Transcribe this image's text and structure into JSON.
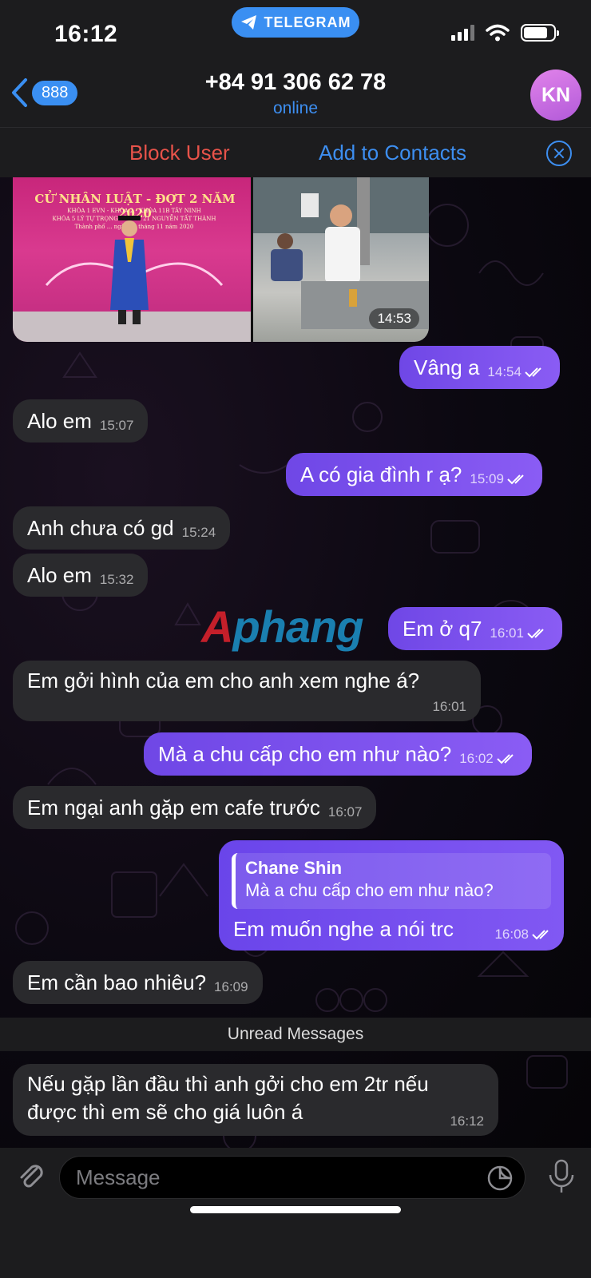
{
  "status_bar": {
    "time": "16:12",
    "app_pill": "TELEGRAM"
  },
  "header": {
    "back_count": "888",
    "title": "+84 91 306 62 78",
    "subtitle": "online",
    "avatar_initials": "KN"
  },
  "actions": {
    "block": "Block User",
    "add": "Add to Contacts"
  },
  "photo_album": {
    "time": "14:53",
    "banner_title": "CỬ NHÂN LUẬT - ĐỢT 2 NĂM 2020",
    "banner_line_1": "KHÓA 1 EVN - KHÓA 2 - KHÓA 11B TÂY NINH",
    "banner_line_2": "KHÓA 5 LÝ TỰ TRỌNG - KHÓA 21 NGUYỄN TẤT THÀNH",
    "banner_line_3": "Thành phố ... ngày 28 tháng 11 năm 2020"
  },
  "messages": [
    {
      "dir": "out",
      "text": "Vâng a",
      "time": "14:54"
    },
    {
      "dir": "in",
      "text": "Alo em",
      "time": "15:07"
    },
    {
      "dir": "out",
      "text": "A có gia đình r ạ?",
      "time": "15:09"
    },
    {
      "dir": "in",
      "text": "Anh chưa có gd",
      "time": "15:24"
    },
    {
      "dir": "in",
      "text": "Alo em",
      "time": "15:32"
    },
    {
      "dir": "out",
      "text": "Em ở q7",
      "time": "16:01"
    },
    {
      "dir": "in",
      "text": "Em gởi hình của em cho anh xem nghe á?",
      "time": "16:01"
    },
    {
      "dir": "out",
      "text": "Mà a chu cấp cho em như nào?",
      "time": "16:02"
    },
    {
      "dir": "in",
      "text": "Em ngại anh gặp em cafe trước",
      "time": "16:07"
    },
    {
      "dir": "out",
      "text": "Em muốn nghe a nói trc",
      "time": "16:08",
      "reply_to": {
        "name": "Chane Shin",
        "text": "Mà a chu cấp cho em như nào?"
      }
    },
    {
      "dir": "in",
      "text": "Em cần bao nhiêu?",
      "time": "16:09"
    },
    {
      "dir": "in",
      "text_line1": "Nếu gặp lần đầu thì anh gởi cho em 2tr nếu",
      "text_line2": "được thì em sẽ cho giá luôn á",
      "time": "16:12"
    }
  ],
  "unread_divider": "Unread Messages",
  "watermark": {
    "first": "A",
    "rest": "phang"
  },
  "input": {
    "placeholder": "Message"
  },
  "colors": {
    "accent": "#3d8ef0",
    "danger": "#e8534a",
    "outgoing": "#7c52ee",
    "incoming": "#2a2a2d"
  }
}
